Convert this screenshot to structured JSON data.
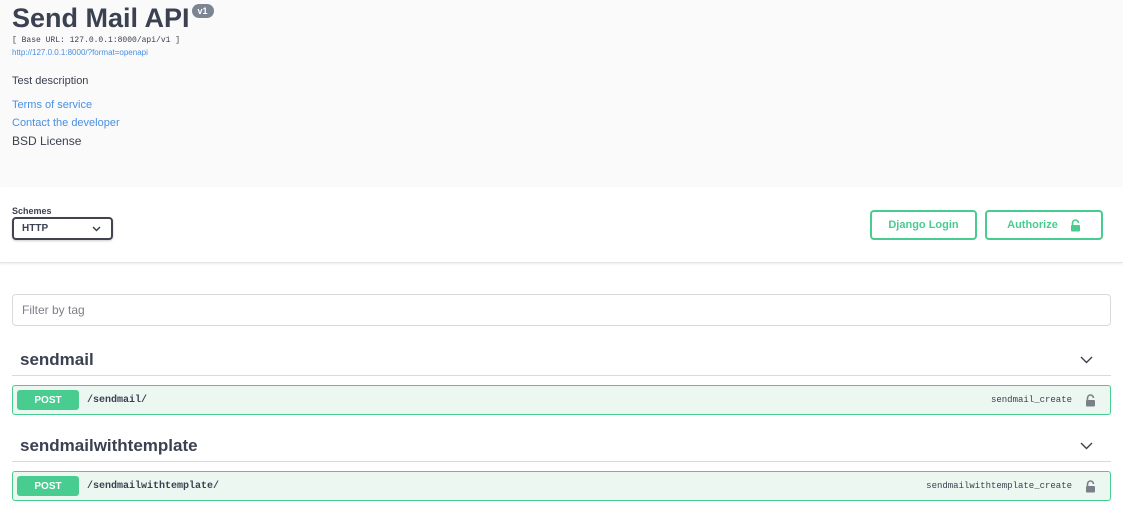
{
  "info": {
    "title": "Send Mail API",
    "version": "v1",
    "base_url": "[ Base URL: 127.0.0.1:8000/api/v1 ]",
    "spec_link": "http://127.0.0.1:8000/?format=openapi",
    "description": "Test description",
    "terms": "Terms of service",
    "contact": "Contact the developer",
    "license": "BSD License"
  },
  "schemes": {
    "label": "Schemes",
    "selected": "HTTP"
  },
  "buttons": {
    "django_login": "Django Login",
    "authorize": "Authorize"
  },
  "filter": {
    "placeholder": "Filter by tag"
  },
  "tags": [
    {
      "name": "sendmail",
      "operation": {
        "method": "POST",
        "path": "/sendmail/",
        "operation_id": "sendmail_create"
      }
    },
    {
      "name": "sendmailwithtemplate",
      "operation": {
        "method": "POST",
        "path": "/sendmailwithtemplate/",
        "operation_id": "sendmailwithtemplate_create"
      }
    }
  ],
  "colors": {
    "post_green": "#49cc90",
    "post_bg": "#ebf7f0",
    "link_blue": "#4990e2",
    "text": "#3b4151"
  },
  "icons": [
    "lock-icon",
    "chevron-down-icon"
  ]
}
